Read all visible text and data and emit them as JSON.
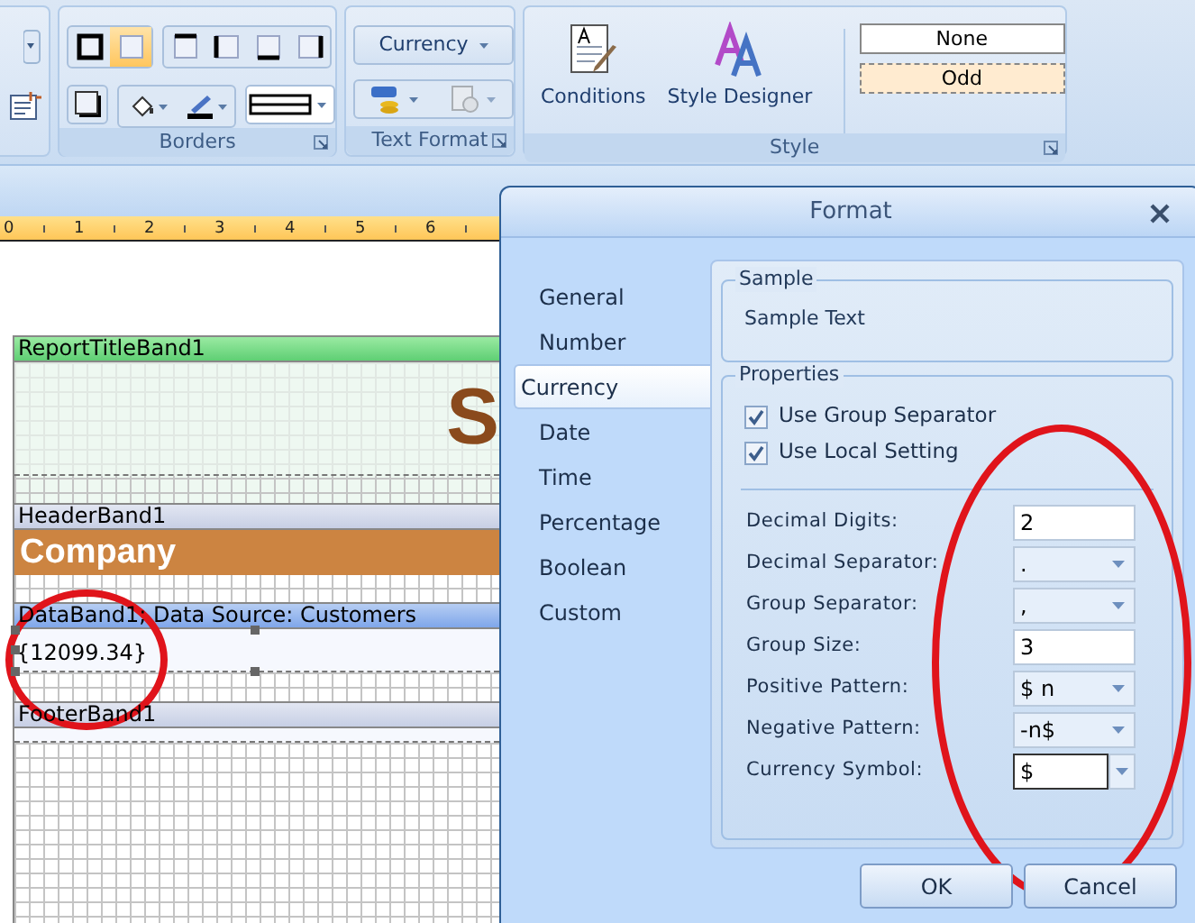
{
  "ribbon": {
    "border_tools": [
      {
        "selected": false
      },
      {
        "selected": true
      },
      {
        "selected": false
      },
      {
        "selected": false
      },
      {
        "selected": false
      },
      {
        "selected": false
      }
    ],
    "borders_group": {
      "label": "Borders"
    },
    "text_format_group": {
      "label": "Text Format",
      "format_button": "Currency"
    },
    "style_group": {
      "label": "Style",
      "buttons": [
        {
          "kind": "conditions",
          "label": "Conditions"
        },
        {
          "kind": "designer",
          "label": "Style Designer"
        }
      ],
      "styles": [
        {
          "label": "None",
          "selected": false
        },
        {
          "label": "Odd",
          "selected": true
        }
      ]
    }
  },
  "ruler": {
    "labels": [
      "0",
      "1",
      "2",
      "3",
      "4",
      "5",
      "6"
    ]
  },
  "report": {
    "bands": [
      {
        "kind": "title",
        "label": "ReportTitleBand1",
        "content": "S"
      },
      {
        "kind": "header",
        "label": "HeaderBand1",
        "content": "Company"
      },
      {
        "kind": "data",
        "label": "DataBand1; Data Source: Customers",
        "content": "{12099.34}"
      },
      {
        "kind": "footer",
        "label": "FooterBand1"
      }
    ]
  },
  "dialog": {
    "title": "Format",
    "categories": [
      {
        "label": "General",
        "selected": false
      },
      {
        "label": "Number",
        "selected": false
      },
      {
        "label": "Currency",
        "selected": true
      },
      {
        "label": "Date",
        "selected": false
      },
      {
        "label": "Time",
        "selected": false
      },
      {
        "label": "Percentage",
        "selected": false
      },
      {
        "label": "Boolean",
        "selected": false
      },
      {
        "label": "Custom",
        "selected": false
      }
    ],
    "sample": {
      "legend": "Sample",
      "text": "Sample Text"
    },
    "properties": {
      "legend": "Properties",
      "checkboxes": [
        {
          "label": "Use Group Separator",
          "checked": true
        },
        {
          "label": "Use Local Setting",
          "checked": true
        }
      ],
      "fields": [
        {
          "label": "Decimal Digits:",
          "value": "2",
          "kind": "text"
        },
        {
          "label": "Decimal Separator:",
          "value": ".",
          "kind": "dropdown"
        },
        {
          "label": "Group Separator:",
          "value": ",",
          "kind": "dropdown"
        },
        {
          "label": "Group Size:",
          "value": "3",
          "kind": "text"
        },
        {
          "label": "Positive Pattern:",
          "value": "$ n",
          "kind": "dropdown"
        },
        {
          "label": "Negative Pattern:",
          "value": "-n$",
          "kind": "dropdown"
        },
        {
          "label": "Currency Symbol:",
          "value": "$",
          "kind": "combo"
        }
      ]
    },
    "buttons": [
      {
        "label": "OK"
      },
      {
        "label": "Cancel"
      }
    ]
  }
}
